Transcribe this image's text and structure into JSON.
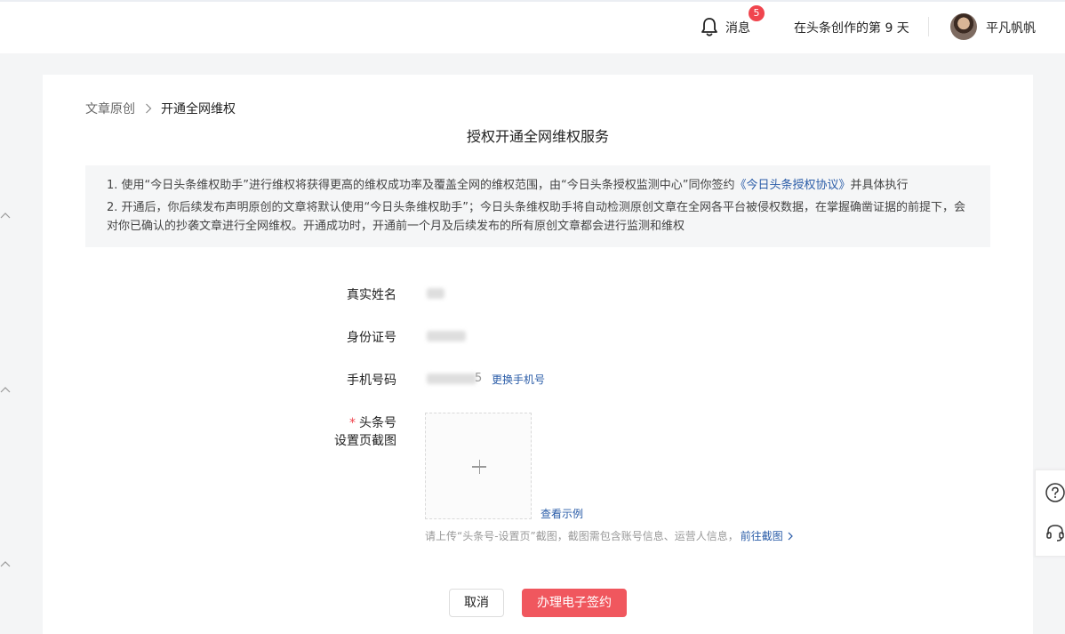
{
  "header": {
    "messages_label": "消息",
    "messages_badge": "5",
    "creation_days_text": "在头条创作的第 9 天",
    "user_name": "平凡帆帆",
    "icons": {
      "bell": "bell-icon",
      "avatar": "user-avatar"
    }
  },
  "breadcrumb": {
    "parent": "文章原创",
    "current": "开通全网维权"
  },
  "page_title": "授权开通全网维权服务",
  "notice": {
    "item1_prefix": "1. 使用“今日头条维权助手”进行维权将获得更高的维权成功率及覆盖全网的维权范围，由“今日头条授权监测中心”同你签约",
    "item1_link": "《今日头条授权协议》",
    "item1_suffix": "并具体执行",
    "item2": "2. 开通后，你后续发布声明原创的文章将默认使用“今日头条维权助手”；今日头条维权助手将自动检测原创文章在全网各平台被侵权数据，在掌握确凿证据的前提下，会对你已确认的抄袭文章进行全网维权。开通成功时，开通前一个月及后续发布的所有原创文章都会进行监测和维权"
  },
  "form": {
    "real_name_label": "真实姓名",
    "id_number_label": "身份证号",
    "phone_label": "手机号码",
    "phone_suffix": "5",
    "change_phone_link": "更换手机号",
    "screenshot_label_line1": "头条号",
    "screenshot_label_line2": "设置页截图",
    "required_mark": "*",
    "view_example_link": "查看示例",
    "upload_hint": "请上传“头条号-设置页”截图，截图需包含账号信息、运营人信息，",
    "go_screenshot_link": "前往截图"
  },
  "actions": {
    "cancel": "取消",
    "sign": "办理电子签约"
  },
  "colors": {
    "accent_red": "#f0575e",
    "link_blue": "#2a5ca8",
    "badge_red": "#f0454e"
  }
}
